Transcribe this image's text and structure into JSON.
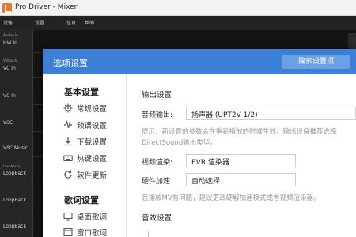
{
  "window": {
    "title": "Pro Driver - Mixer"
  },
  "menubar": {
    "items": [
      "设备",
      "设置",
      "信息",
      "帮助"
    ]
  },
  "channels": [
    "Analog In",
    "HW In",
    "Virtual In",
    "VC In",
    "VC In",
    "VSC",
    "VSC Music",
    "Loopbacks",
    "LoopBack",
    "LoopBack",
    "LoopBack"
  ],
  "dialog": {
    "title": "选项设置",
    "search_label": "搜索设置项",
    "nav": {
      "basic_title": "基本设置",
      "basic_items": [
        "常规设置",
        "频谱设置",
        "下载设置",
        "热键设置",
        "软件更新"
      ],
      "lyrics_title": "歌词设置",
      "lyrics_items": [
        "桌面歌词",
        "窗口歌词"
      ]
    },
    "content": {
      "output_title": "输出设置",
      "audio_output_label": "音频输出:",
      "audio_output_value": "扬声器 (UPT2V 1/2)",
      "hint_line1": "提示：新设置的参数会在重新播放的时候生效。输出设备推荐选择",
      "hint_line2": "DirectSound输出类型。",
      "video_render_label": "视频渲染:",
      "video_render_value": "EVR 渲染器",
      "hw_accel_label": "硬件加速",
      "hw_accel_value": "自动选择",
      "mv_hint": "若播放MV有问题，建议更改硬解加速模式或者视频渲染器。",
      "effects_title": "音效设置"
    }
  }
}
